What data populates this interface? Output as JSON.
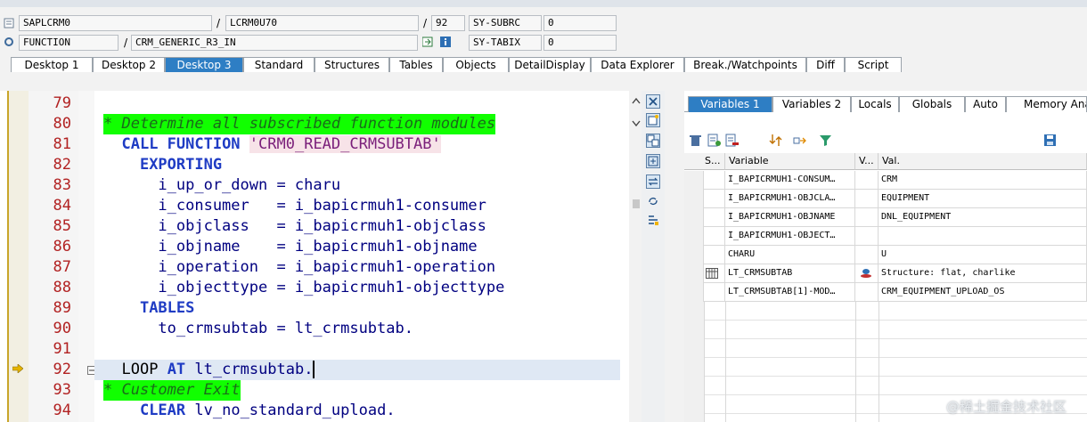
{
  "header": {
    "row1": {
      "program": "SAPLCRM0",
      "include": "LCRM0U70",
      "line": "92",
      "sysfield1_label": "SY-SUBRC",
      "sysfield1_value": "0"
    },
    "row2": {
      "event_type": "FUNCTION",
      "event_name": "CRM_GENERIC_R3_IN",
      "sysfield2_label": "SY-TABIX",
      "sysfield2_value": "0"
    },
    "separator": "/"
  },
  "tabs": [
    {
      "label": "Desktop 1"
    },
    {
      "label": "Desktop 2"
    },
    {
      "label": "Desktop 3"
    },
    {
      "label": "Standard"
    },
    {
      "label": "Structures"
    },
    {
      "label": "Tables"
    },
    {
      "label": "Objects"
    },
    {
      "label": "DetailDisplay"
    },
    {
      "label": "Data Explorer"
    },
    {
      "label": "Break./Watchpoints"
    },
    {
      "label": "Diff"
    },
    {
      "label": "Script"
    }
  ],
  "active_tab": "Desktop 3",
  "code": {
    "line_numbers": [
      "79",
      "80",
      "81",
      "82",
      "83",
      "84",
      "85",
      "86",
      "87",
      "88",
      "89",
      "90",
      "91",
      "92",
      "93",
      "94"
    ],
    "lines": [
      "",
      "* Determine all subscribed function modules",
      "  CALL FUNCTION 'CRM0_READ_CRMSUBTAB'",
      "    EXPORTING",
      "      i_up_or_down = charu",
      "      i_consumer   = i_bapicrmuh1-consumer",
      "      i_objclass   = i_bapicrmuh1-objclass",
      "      i_objname    = i_bapicrmuh1-objname",
      "      i_operation  = i_bapicrmuh1-operation",
      "      i_objecttype = i_bapicrmuh1-objecttype",
      "    TABLES",
      "      to_crmsubtab = lt_crmsubtab.",
      "",
      "  LOOP AT lt_crmsubtab.",
      "* Customer Exit",
      "    CLEAR lv_no_standard_upload."
    ],
    "current_line": "92"
  },
  "vars": {
    "tabs": [
      {
        "label": "Variables 1"
      },
      {
        "label": "Variables 2"
      },
      {
        "label": "Locals"
      },
      {
        "label": "Globals"
      },
      {
        "label": "Auto"
      },
      {
        "label": "Memory Anal"
      }
    ],
    "active_tab": "Variables 1",
    "columns": {
      "s": "S...",
      "variable": "Variable",
      "v": "V...",
      "value": "Val."
    },
    "rows": [
      {
        "variable": "I_BAPICRMUH1-CONSUM…",
        "value": "CRM"
      },
      {
        "variable": "I_BAPICRMUH1-OBJCLA…",
        "value": "EQUIPMENT"
      },
      {
        "variable": "I_BAPICRMUH1-OBJNAME",
        "value": "DNL_EQUIPMENT"
      },
      {
        "variable": "I_BAPICRMUH1-OBJECT…",
        "value": ""
      },
      {
        "variable": "CHARU",
        "value": "U"
      },
      {
        "variable": "LT_CRMSUBTAB",
        "value": "Structure: flat, charlike"
      },
      {
        "variable": "LT_CRMSUBTAB[1]-MOD…",
        "value": "CRM_EQUIPMENT_UPLOAD_OS"
      }
    ]
  },
  "watermark": "@稀土掘金技术社区",
  "colors": {
    "accent": "#2e7ec4",
    "keyword": "#1f3cc4",
    "comment_bg": "#11ff00",
    "line_number": "#b22222"
  }
}
